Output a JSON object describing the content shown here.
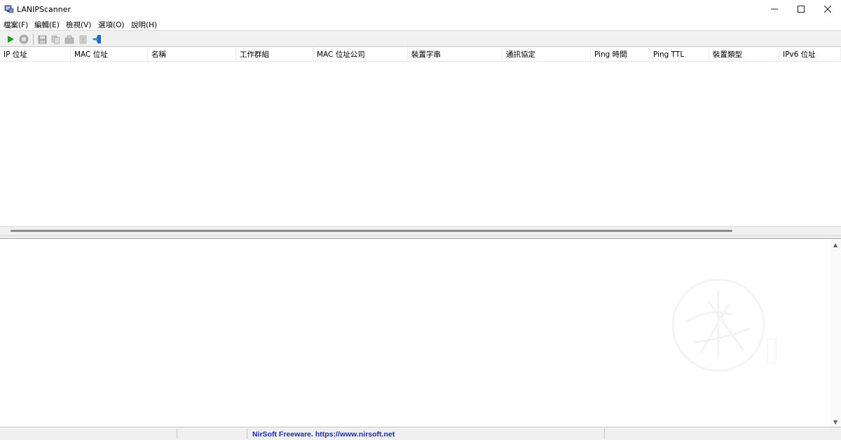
{
  "window": {
    "title": "LANIPScanner",
    "app_icon": "network-scanner-icon",
    "controls": [
      "minimize-icon",
      "maximize-icon",
      "close-icon"
    ]
  },
  "menu": {
    "file": "檔案(F)",
    "edit": "編輯(E)",
    "view": "檢視(V)",
    "options": "選項(O)",
    "help": "說明(H)"
  },
  "toolbar": {
    "buttons": [
      "start-scan-icon",
      "stop-scan-icon",
      "save-icon",
      "copy-icon",
      "properties-icon",
      "html-report-icon",
      "exit-icon"
    ],
    "accent_start": "#1a9c1a",
    "accent_exit": "#1a6fbf"
  },
  "list": {
    "columns": [
      "IP 位址",
      "MAC 位址",
      "名稱",
      "工作群組",
      "MAC 位址公司",
      "裝置字串",
      "通訊協定",
      "Ping 時間",
      "Ping TTL",
      "裝置類型",
      "IPv6 位址"
    ]
  },
  "status": {
    "link_text": "NirSoft Freeware. https://www.nirsoft.net",
    "link_color": "#1a2fa0"
  }
}
